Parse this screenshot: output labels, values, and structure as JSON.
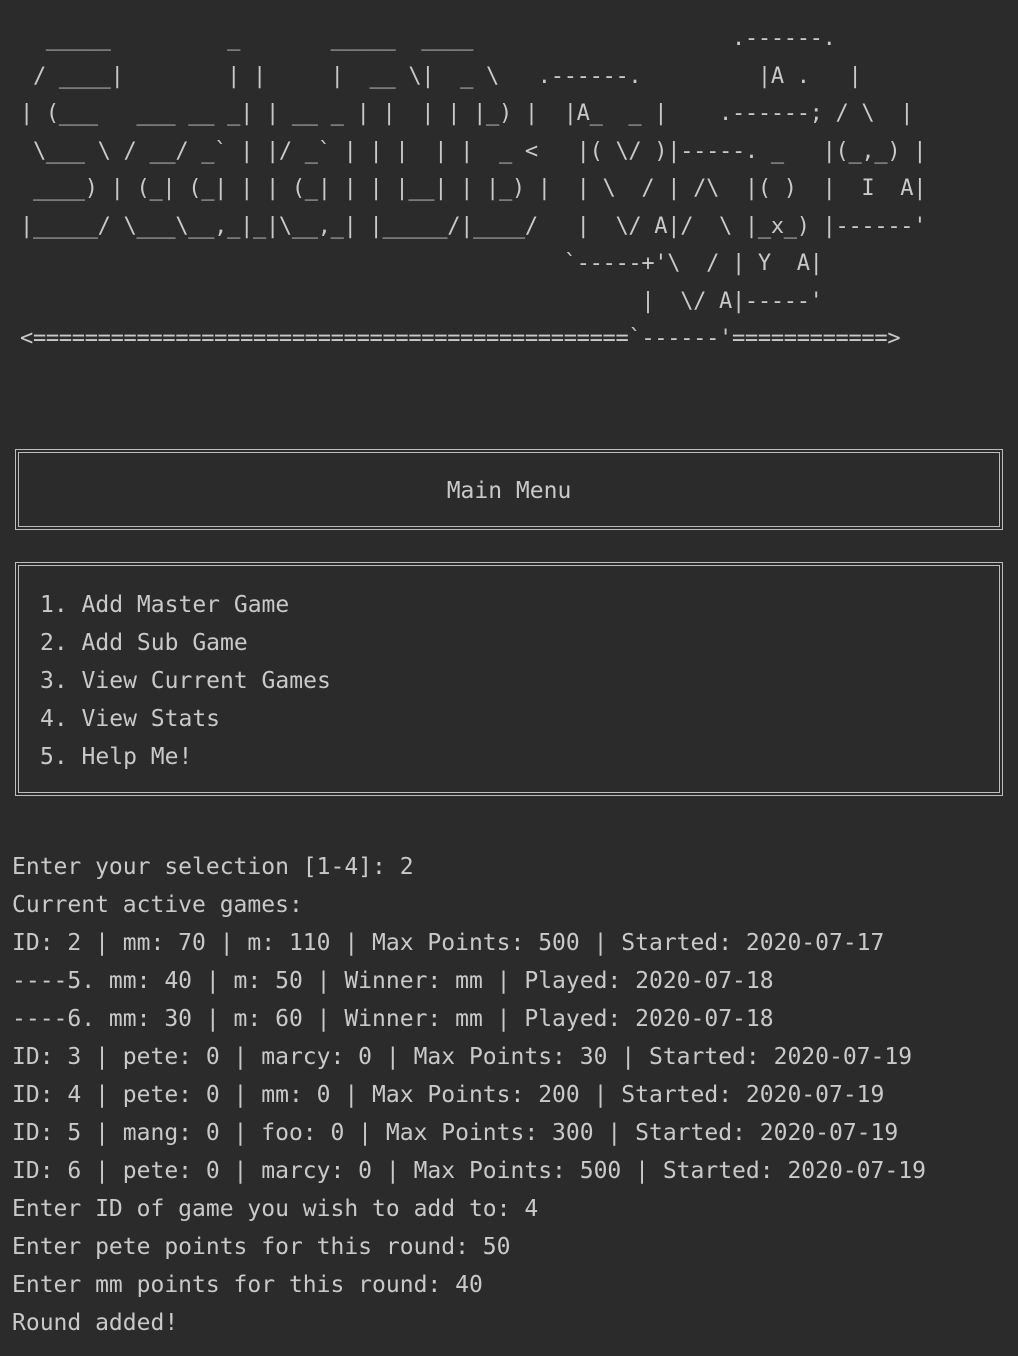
{
  "banner": {
    "ascii_art": "  _____         _       _____  ____                    .------.\n / ____|        | |     |  __ \\|  _ \\   .------.         |A .   |\n| (___   ___ __ _| | __ _ | |  | | |_) |  |A_  _ |    .------; / \\  |\n \\___ \\ / __/ _` | |/ _` | | |  | |  _ <   |( \\/ )|-----. _   |(_,_) |\n ____) | (_| (_| | | (_| | | |__| | |_) |  | \\  / | /\\  |( )  |  I  A|\n|_____/ \\___\\__,_|_|\\__,_| |_____/|____/   |  \\/ A|/  \\ |_x_) |------'\n                                          `-----+'\\  / | Y  A|\n                                                |  \\/ A|-----'\n<==============================================`------'============>"
  },
  "menu_title": "Main Menu",
  "menu_items": [
    "1. Add Master Game",
    "2. Add Sub Game",
    "3. View Current Games",
    "4. View Stats",
    "5. Help Me!"
  ],
  "output_lines": [
    "Enter your selection [1-4]: 2",
    "Current active games:",
    "ID: 2 | mm: 70 | m: 110 | Max Points: 500 | Started: 2020-07-17",
    "----5. mm: 40 | m: 50 | Winner: mm | Played: 2020-07-18",
    "----6. mm: 30 | m: 60 | Winner: mm | Played: 2020-07-18",
    "ID: 3 | pete: 0 | marcy: 0 | Max Points: 30 | Started: 2020-07-19",
    "ID: 4 | pete: 0 | mm: 0 | Max Points: 200 | Started: 2020-07-19",
    "ID: 5 | mang: 0 | foo: 0 | Max Points: 300 | Started: 2020-07-19",
    "ID: 6 | pete: 0 | marcy: 0 | Max Points: 500 | Started: 2020-07-19",
    "Enter ID of game you wish to add to: 4",
    "Enter pete points for this round: 50",
    "Enter mm points for this round: 40",
    "Round added!"
  ],
  "colors": {
    "background": "#2b2b2b",
    "text": "#c9c9c9",
    "border": "#bdbdbd"
  }
}
